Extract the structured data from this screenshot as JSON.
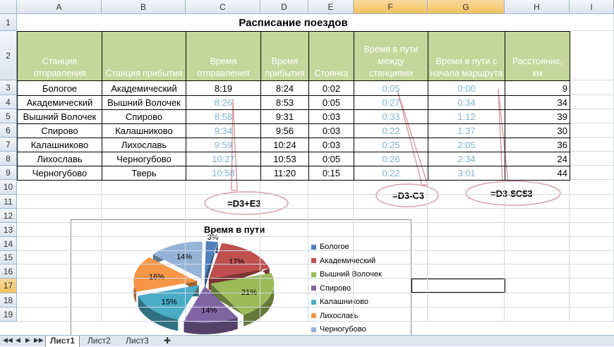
{
  "columns": [
    "A",
    "B",
    "C",
    "D",
    "E",
    "F",
    "G",
    "H",
    "I"
  ],
  "rows": [
    "1",
    "2",
    "3",
    "4",
    "5",
    "6",
    "7",
    "8",
    "9",
    "10",
    "11",
    "12",
    "13",
    "14",
    "15",
    "16",
    "17",
    "18",
    "19"
  ],
  "title": "Расписание поездов",
  "headers": [
    "Станция отправления",
    "Станция прибытия",
    "Время отправления",
    "Время прибытия",
    "Стоянка",
    "Время в пути между станциями",
    "Время в пути с начала маршрута",
    "Расстояние, км"
  ],
  "table": [
    [
      "Бологое",
      "Академический",
      "8:19",
      "8:24",
      "0:02",
      "0:05",
      "0:00",
      "9"
    ],
    [
      "Академический",
      "Вышний Волочек",
      "8:26",
      "8:53",
      "0:05",
      "0:27",
      "0:34",
      "34"
    ],
    [
      "Вышний Волочек",
      "Спирово",
      "8:58",
      "9:31",
      "0:03",
      "0:33",
      "1:12",
      "39"
    ],
    [
      "Спирово",
      "Калашниково",
      "9:34",
      "9:56",
      "0:03",
      "0:22",
      "1:37",
      "30"
    ],
    [
      "Калашниково",
      "Лихославь",
      "9:59",
      "10:24",
      "0:03",
      "0:25",
      "2:05",
      "36"
    ],
    [
      "Лихославь",
      "Черногубово",
      "10:27",
      "10:53",
      "0:05",
      "0:26",
      "2:34",
      "24"
    ],
    [
      "Черногубово",
      "Тверь",
      "10:58",
      "11:20",
      "0:15",
      "0:22",
      "3:01",
      "44"
    ]
  ],
  "callouts": {
    "c": "=D3+E3",
    "f": "=D3-C3",
    "g": "=D3-$C$3"
  },
  "chart_data": {
    "type": "pie",
    "title": "Время в пути",
    "categories": [
      "Бологое",
      "Академический",
      "Вышний Волочек",
      "Спирово",
      "Калашниково",
      "Лихославь",
      "Черногубово"
    ],
    "values": [
      3,
      17,
      21,
      14,
      15,
      16,
      14
    ],
    "labels": [
      "3%",
      "17%",
      "21%",
      "14%",
      "15%",
      "16%",
      "14%"
    ],
    "colors": [
      "#4f81bd",
      "#c0504d",
      "#9bbb59",
      "#8064a2",
      "#4bacc6",
      "#f79646",
      "#95b3d7"
    ],
    "legend": "right"
  },
  "tabs": [
    "Лист1",
    "Лист2",
    "Лист3"
  ],
  "active_tab": "Лист1",
  "selected_cell": "F17:G17"
}
